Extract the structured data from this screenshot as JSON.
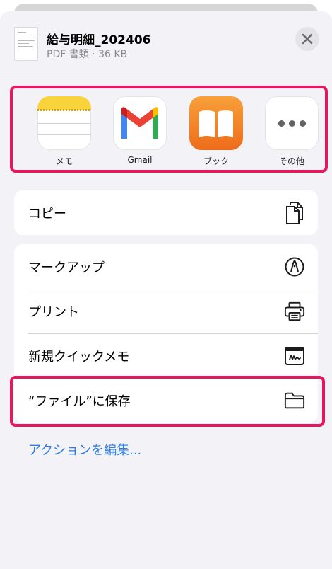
{
  "header": {
    "title": "給与明細_202406",
    "subtitle": "PDF 書類 · 36 KB"
  },
  "apps": [
    {
      "label": "メモ",
      "icon": "notes-app-icon"
    },
    {
      "label": "Gmail",
      "icon": "gmail-app-icon"
    },
    {
      "label": "ブック",
      "icon": "books-app-icon"
    },
    {
      "label": "その他",
      "icon": "more-dots-icon"
    }
  ],
  "actions": {
    "copy": "コピー",
    "markup": "マークアップ",
    "print": "プリント",
    "quick_note": "新規クイックメモ",
    "save_to_files": "“ファイル”に保存",
    "edit_actions": "アクションを編集..."
  },
  "colors": {
    "highlight": "#e8175d",
    "link": "#2f7de1",
    "sheet_bg": "#f2f2f7"
  }
}
